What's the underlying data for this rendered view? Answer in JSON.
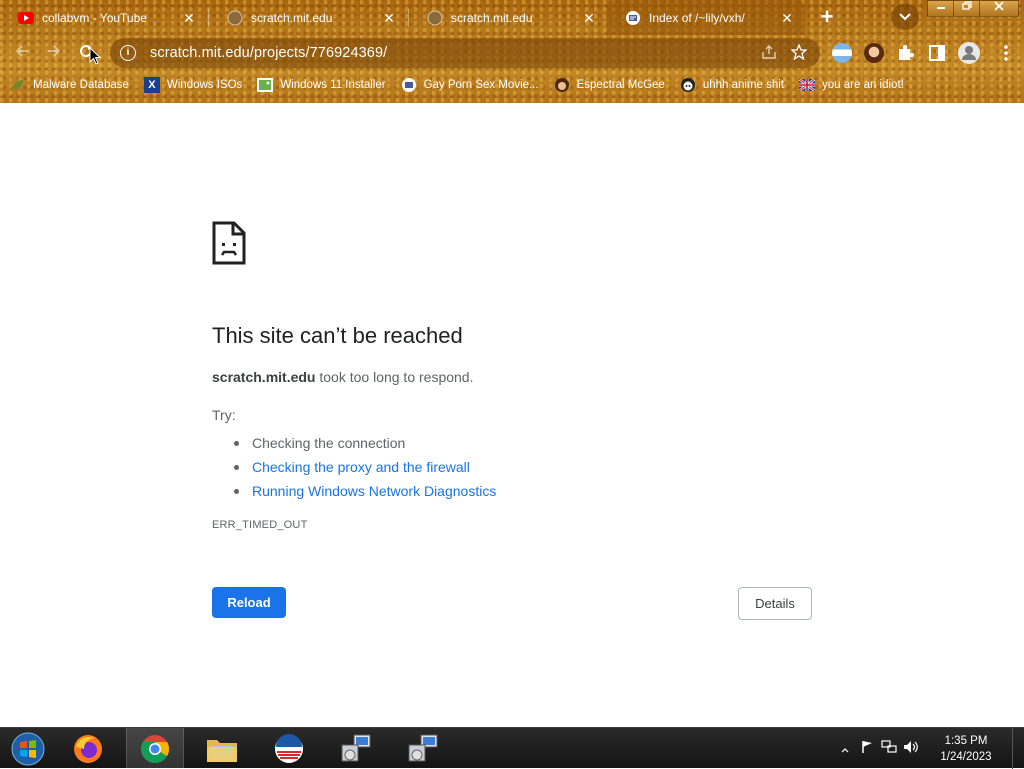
{
  "tabs": [
    {
      "title": "collabvm - YouTube",
      "favicon": "youtube-icon",
      "active": false
    },
    {
      "title": "scratch.mit.edu",
      "favicon": "globe-icon",
      "active": false
    },
    {
      "title": "scratch.mit.edu",
      "favicon": "globe-icon",
      "active": false
    },
    {
      "title": "Index of /~lily/vxh/",
      "favicon": "folder-index-icon",
      "active": true
    }
  ],
  "tab_close_glyph": "✕",
  "new_tab_glyph": "+",
  "omnibox": {
    "url": "scratch.mit.edu/projects/776924369/"
  },
  "bookmarks": [
    {
      "label": "Malware Database",
      "icon": "leaf-icon"
    },
    {
      "label": "Windows ISOs",
      "icon": "x-logo-icon"
    },
    {
      "label": "Windows 11 Installer",
      "icon": "image-icon"
    },
    {
      "label": "Gay Porn Sex Movie...",
      "icon": "index-icon"
    },
    {
      "label": "Espectral McGee",
      "icon": "avatar-icon"
    },
    {
      "label": "uhhh anime shit",
      "icon": "anime-icon"
    },
    {
      "label": "you are an idiot!",
      "icon": "flag-icon"
    }
  ],
  "error": {
    "title": "This site can’t be reached",
    "host": "scratch.mit.edu",
    "message": " took too long to respond.",
    "try_label": "Try:",
    "suggestions": [
      {
        "text": "Checking the connection",
        "link": false
      },
      {
        "text": "Checking the proxy and the firewall",
        "link": true
      },
      {
        "text": "Running Windows Network Diagnostics",
        "link": true
      }
    ],
    "code": "ERR_TIMED_OUT",
    "reload_label": "Reload",
    "details_label": "Details"
  },
  "colors": {
    "accent_blue": "#1a73e8",
    "chrome_theme": "#b97a1c",
    "taskbar": "#1c1c1c"
  },
  "taskbar": {
    "items": [
      "start-orb-icon",
      "firefox-icon",
      "chrome-icon",
      "file-explorer-icon",
      "obama-logo-icon",
      "network-setup-icon",
      "network-setup-icon"
    ],
    "clock_time": "1:35 PM",
    "clock_date": "1/24/2023"
  }
}
